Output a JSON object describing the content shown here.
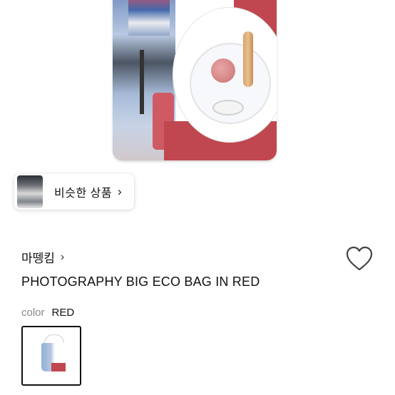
{
  "similar": {
    "label": "비슷한 상품"
  },
  "brand": {
    "name": "마뗑킴"
  },
  "product": {
    "title": "PHOTOGRAPHY BIG ECO BAG IN RED"
  },
  "color": {
    "key": "color",
    "value": "RED"
  },
  "icons": {
    "similar_chevron": "chevron-right-icon",
    "brand_chevron": "chevron-right-icon",
    "wishlist": "heart-outline-icon"
  },
  "colors": {
    "accent_red": "#c0474f",
    "text": "#111111",
    "muted": "#888888"
  }
}
